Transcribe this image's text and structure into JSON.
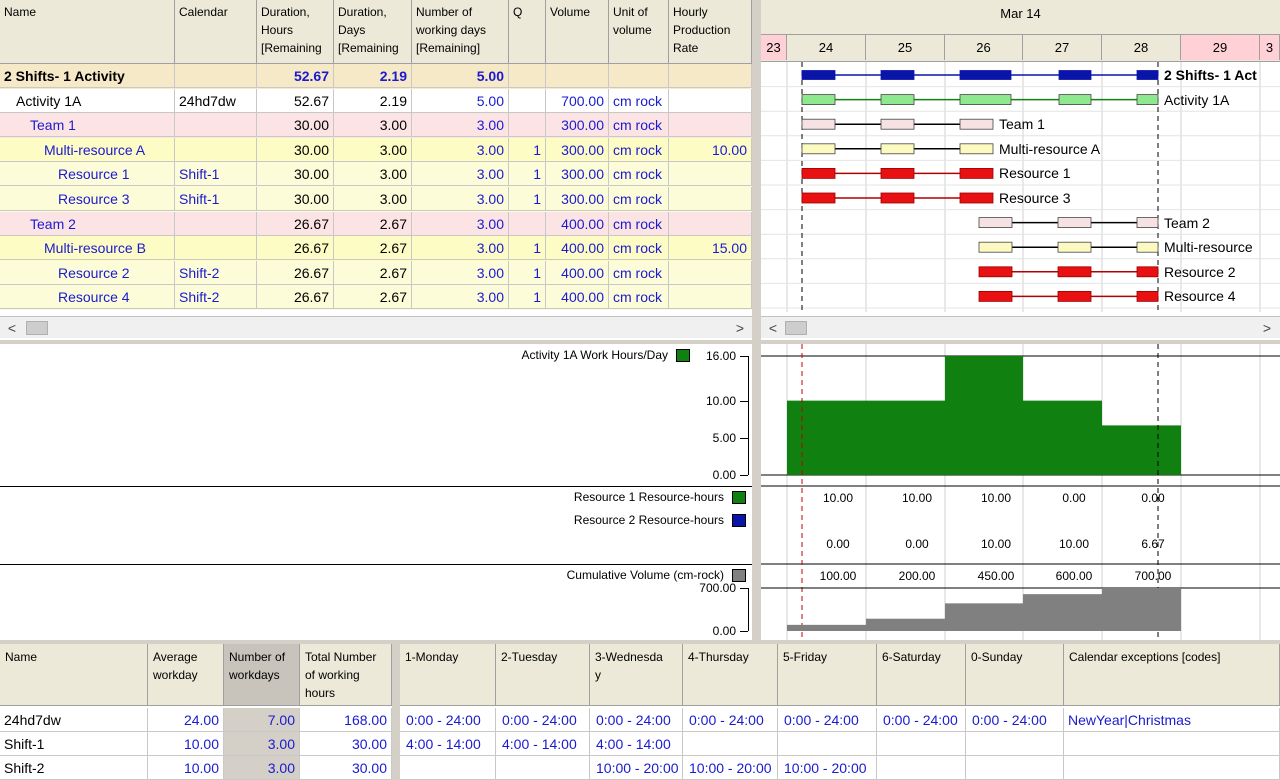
{
  "top_table": {
    "columns": [
      "Name",
      "Calendar",
      "Duration,\nHours\n[Remaining",
      "Duration,\nDays\n[Remaining",
      "Number of\nworking days\n[Remaining]",
      "Q",
      "Volume",
      "Unit of\nvolume",
      "Hourly\nProduction\nRate"
    ],
    "rows": [
      {
        "name": "2 Shifts- 1 Activity",
        "calendar": "",
        "hours": "52.67",
        "days": "2.19",
        "wdays": "5.00",
        "q": "",
        "volume": "",
        "unit": "",
        "rate": "",
        "bg": "#f5e9c8",
        "indent": 0,
        "bold": true,
        "blue": false
      },
      {
        "name": "Activity  1A",
        "calendar": "24hd7dw",
        "hours": "52.67",
        "days": "2.19",
        "wdays": "5.00",
        "q": "",
        "volume": "700.00",
        "unit": "cm rock",
        "rate": "",
        "bg": "#ffffff",
        "indent": 12,
        "bold": false,
        "blue": false
      },
      {
        "name": "Team 1",
        "calendar": "",
        "hours": "30.00",
        "days": "3.00",
        "wdays": "3.00",
        "q": "",
        "volume": "300.00",
        "unit": "cm rock",
        "rate": "",
        "bg": "#fde4e4",
        "indent": 26,
        "bold": false,
        "blue": true
      },
      {
        "name": "Multi-resource A",
        "calendar": "",
        "hours": "30.00",
        "days": "3.00",
        "wdays": "3.00",
        "q": "1",
        "volume": "300.00",
        "unit": "cm rock",
        "rate": "10.00",
        "bg": "#fcfcc4",
        "indent": 40,
        "bold": false,
        "blue": true
      },
      {
        "name": "Resource  1",
        "calendar": "Shift-1",
        "hours": "30.00",
        "days": "3.00",
        "wdays": "3.00",
        "q": "1",
        "volume": "300.00",
        "unit": "cm rock",
        "rate": "",
        "bg": "#fcfcd8",
        "indent": 54,
        "bold": false,
        "blue": true
      },
      {
        "name": "Resource 3",
        "calendar": "Shift-1",
        "hours": "30.00",
        "days": "3.00",
        "wdays": "3.00",
        "q": "1",
        "volume": "300.00",
        "unit": "cm rock",
        "rate": "",
        "bg": "#fcfcd8",
        "indent": 54,
        "bold": false,
        "blue": true
      },
      {
        "name": "Team 2",
        "calendar": "",
        "hours": "26.67",
        "days": "2.67",
        "wdays": "3.00",
        "q": "",
        "volume": "400.00",
        "unit": "cm rock",
        "rate": "",
        "bg": "#fde4e4",
        "indent": 26,
        "bold": false,
        "blue": true
      },
      {
        "name": "Multi-resource B",
        "calendar": "",
        "hours": "26.67",
        "days": "2.67",
        "wdays": "3.00",
        "q": "1",
        "volume": "400.00",
        "unit": "cm rock",
        "rate": "15.00",
        "bg": "#fcfcc4",
        "indent": 40,
        "bold": false,
        "blue": true
      },
      {
        "name": "Resource  2",
        "calendar": "Shift-2",
        "hours": "26.67",
        "days": "2.67",
        "wdays": "3.00",
        "q": "1",
        "volume": "400.00",
        "unit": "cm rock",
        "rate": "",
        "bg": "#fcfcd8",
        "indent": 54,
        "bold": false,
        "blue": true
      },
      {
        "name": "Resource 4",
        "calendar": "Shift-2",
        "hours": "26.67",
        "days": "2.67",
        "wdays": "3.00",
        "q": "1",
        "volume": "400.00",
        "unit": "cm rock",
        "rate": "",
        "bg": "#fcfcd8",
        "indent": 54,
        "bold": false,
        "blue": true
      }
    ]
  },
  "gantt": {
    "month": "Mar 14",
    "days": [
      "23",
      "24",
      "25",
      "26",
      "27",
      "28",
      "29",
      "3"
    ],
    "bar_labels": [
      "2 Shifts- 1 Act",
      "Activity  1A",
      "Team 1",
      "Multi-resource A",
      "Resource  1",
      "Resource 3",
      "Team 2",
      "Multi-resource",
      "Resource  2",
      "Resource 4"
    ],
    "colors": {
      "summary": "#0a14a8",
      "activity": "#8ee88e",
      "team": "#f6e2e2",
      "multi": "#fcfac0",
      "resource": "#e81010"
    }
  },
  "scroll": {
    "left": "<",
    "right": ">"
  },
  "chart_data": [
    {
      "type": "bar",
      "title": "Activity  1A  Work Hours/Day",
      "categories": [
        "24",
        "25",
        "26",
        "27",
        "28"
      ],
      "values": [
        10,
        10,
        16,
        10,
        6.67
      ],
      "ylim": [
        0,
        16
      ],
      "yticks": [
        "16.00",
        "10.00",
        "5.00",
        "0.00"
      ],
      "color": "#108010"
    },
    {
      "type": "table",
      "series": [
        {
          "name": "Resource  1 Resource-hours",
          "color": "#108010",
          "values": [
            "10.00",
            "10.00",
            "10.00",
            "0.00",
            "0.00"
          ]
        },
        {
          "name": "Resource  2 Resource-hours",
          "color": "#0a14a8",
          "values": [
            "0.00",
            "0.00",
            "10.00",
            "10.00",
            "6.67"
          ]
        }
      ]
    },
    {
      "type": "area",
      "title": "Cumulative Volume (cm-rock)",
      "categories": [
        "24",
        "25",
        "26",
        "27",
        "28"
      ],
      "values": [
        100,
        200,
        450,
        600,
        700
      ],
      "labels": [
        "100.00",
        "200.00",
        "450.00",
        "600.00",
        "700.00"
      ],
      "ylim": [
        0,
        700
      ],
      "yticks": [
        "700.00",
        "0.00"
      ],
      "color": "#808080"
    }
  ],
  "calendar_table": {
    "left_columns": [
      "Name",
      "Average\nworkday",
      "Number of\nworkdays",
      "Total Number\nof working\nhours"
    ],
    "right_columns": [
      "1-Monday",
      "2-Tuesday",
      "3-Wednesda\ny",
      "4-Thursday",
      "5-Friday",
      "6-Saturday",
      "0-Sunday",
      "Calendar exceptions [codes]"
    ],
    "rows": [
      {
        "name": "24hd7dw",
        "avg": "24.00",
        "num": "7.00",
        "total": "168.00",
        "days": [
          "0:00 - 24:00",
          "0:00 - 24:00",
          "0:00 - 24:00",
          "0:00 - 24:00",
          "0:00 - 24:00",
          "0:00 - 24:00",
          "0:00 - 24:00"
        ],
        "exceptions": "NewYear|Christmas"
      },
      {
        "name": "Shift-1",
        "avg": "10.00",
        "num": "3.00",
        "total": "30.00",
        "days": [
          "4:00 - 14:00",
          "4:00 - 14:00",
          "4:00 - 14:00",
          "",
          "",
          "",
          ""
        ],
        "exceptions": ""
      },
      {
        "name": "Shift-2",
        "avg": "10.00",
        "num": "3.00",
        "total": "30.00",
        "days": [
          "",
          "",
          "10:00 - 20:00",
          "10:00 - 20:00",
          "10:00 - 20:00",
          "",
          ""
        ],
        "exceptions": ""
      }
    ]
  }
}
